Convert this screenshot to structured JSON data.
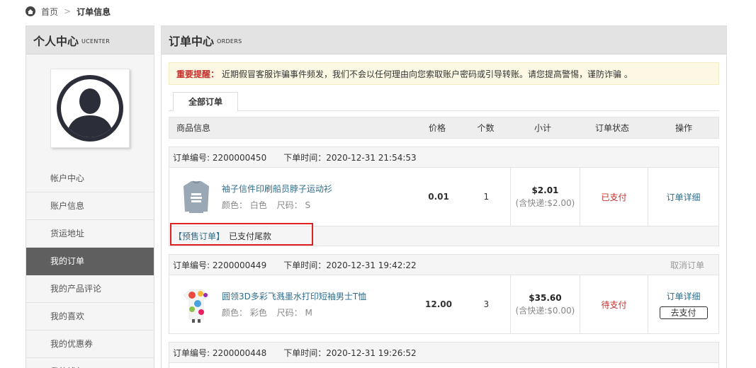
{
  "breadcrumb": {
    "home": "首页",
    "separator": ">",
    "current": "订单信息"
  },
  "sidebar": {
    "title": "个人中心",
    "subtitle": "UCENTER",
    "items": [
      {
        "label": "帐户中心"
      },
      {
        "label": "账户信息"
      },
      {
        "label": "货运地址"
      },
      {
        "label": "我的订单",
        "active": true
      },
      {
        "label": "我的产品评论"
      },
      {
        "label": "我的喜欢"
      },
      {
        "label": "我的优惠券"
      },
      {
        "label": "我的钱包"
      }
    ]
  },
  "main": {
    "title": "订单中心",
    "subtitle": "ORDERS",
    "notice": {
      "label": "重要提醒：",
      "text": "近期假冒客服诈骗事件频发，我们不会以任何理由向您索取账户密码或引导转账。请您提高警惕，谨防诈骗 。"
    },
    "tab": "全部订单",
    "columns": {
      "info": "商品信息",
      "price": "价格",
      "qty": "个数",
      "subtotal": "小计",
      "status": "订单状态",
      "op": "操作"
    }
  },
  "orders": [
    {
      "number": "订单编号: 2200000450",
      "time": "下单时间：2020-12-31 21:54:53",
      "goods_name": "袖子信件印刷船员脖子运动衫",
      "color": "颜色：  白色",
      "size": "尺码：  S",
      "price": "0.01",
      "qty": "1",
      "amount": "$2.01",
      "shipping": "(含快递:$2.00)",
      "status": "已支付",
      "detail": "订单详细",
      "presale_tag": "【预售订单】",
      "presale_text": "已支付尾款"
    },
    {
      "number": "订单编号: 2200000449",
      "time": "下单时间：2020-12-31 19:42:22",
      "cancel": "取消订单",
      "goods_name": "圆领3D多彩飞溅墨水打印短袖男士T恤",
      "color": "颜色：  彩色",
      "size": "尺码：  M",
      "price": "12.00",
      "qty": "3",
      "amount": "$35.60",
      "shipping": "(含快递:$0.00)",
      "status": "待支付",
      "detail": "订单详细",
      "pay": "去支付"
    },
    {
      "number": "订单编号: 2200000448",
      "time": "下单时间：2020-12-31 19:26:52"
    }
  ],
  "colors": {
    "accent_link": "#2e6e8e",
    "status_red": "#c9302c",
    "highlight": "#e02020",
    "active_menu": "#5f5f5f"
  }
}
